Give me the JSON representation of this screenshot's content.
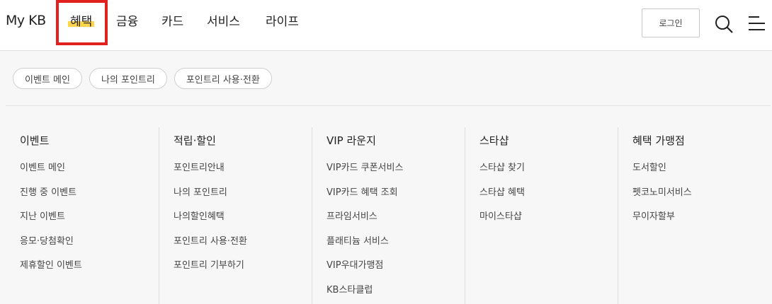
{
  "header": {
    "brand": "My KB",
    "nav": [
      "혜택",
      "금융",
      "카드",
      "서비스",
      "라이프"
    ],
    "login_label": "로그인",
    "search_icon": "search-icon",
    "menu_icon": "menu-icon"
  },
  "quick_links": [
    "이벤트 메인",
    "나의 포인트리",
    "포인트리 사용·전환"
  ],
  "columns": [
    {
      "title": "이벤트",
      "items": [
        "이벤트 메인",
        "진행 중 이벤트",
        "지난 이벤트",
        "응모·당첨확인",
        "제휴할인 이벤트"
      ]
    },
    {
      "title": "적립·할인",
      "items": [
        "포인트리안내",
        "나의 포인트리",
        "나의할인혜택",
        "포인트리 사용·전환",
        "포인트리 기부하기"
      ]
    },
    {
      "title": "VIP 라운지",
      "items": [
        "VIP카드 쿠폰서비스",
        "VIP카드 혜택 조회",
        "프라임서비스",
        "플래티늄 서비스",
        "VIP우대가맹점",
        "KB스타클럽"
      ]
    },
    {
      "title": "스타샵",
      "items": [
        "스타샵 찾기",
        "스타샵 혜택",
        "마이스타샵"
      ]
    },
    {
      "title": "혜택 가맹점",
      "items": [
        "도서할인",
        "펫코노미서비스",
        "무이자할부"
      ]
    }
  ],
  "colors": {
    "highlight": "#ffd54a",
    "focus_box": "#e0211d"
  }
}
